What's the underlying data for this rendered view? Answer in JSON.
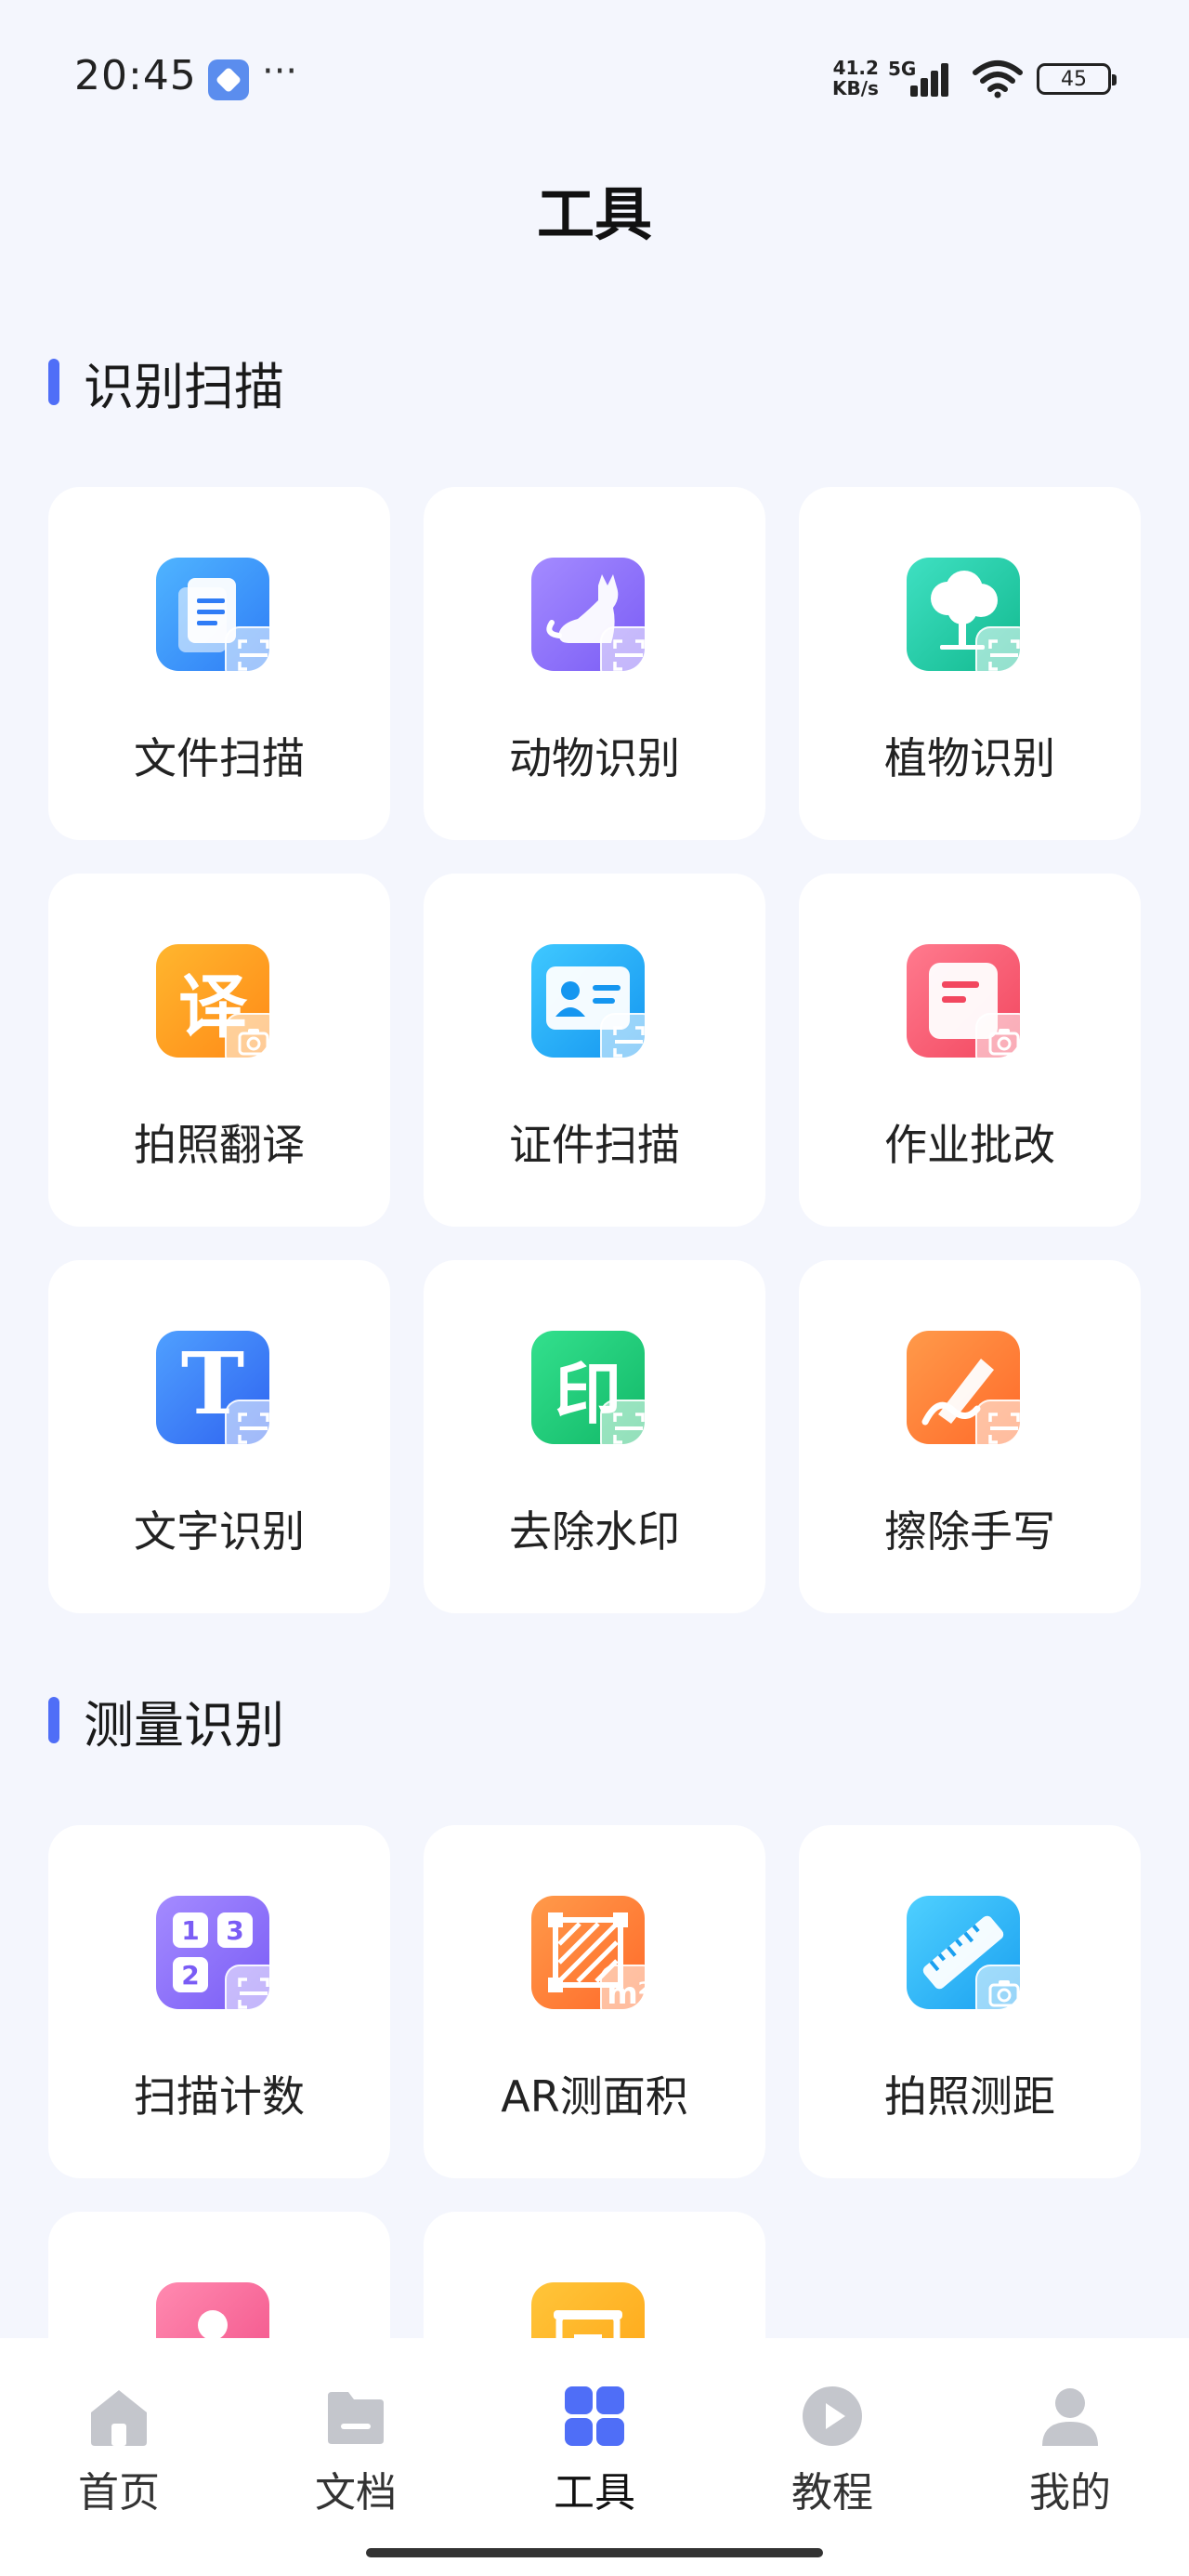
{
  "status_bar": {
    "time": "20:45",
    "more": "···",
    "net_speed_value": "41.2",
    "net_speed_unit": "KB/s",
    "net_type": "5G",
    "battery": "45"
  },
  "page": {
    "title": "工具"
  },
  "sections": [
    {
      "title": "识别扫描",
      "tools": [
        {
          "label": "文件扫描",
          "icon": "document-scan-icon"
        },
        {
          "label": "动物识别",
          "icon": "cat-scan-icon"
        },
        {
          "label": "植物识别",
          "icon": "tree-scan-icon"
        },
        {
          "label": "拍照翻译",
          "icon": "translate-camera-icon",
          "glyph": "译"
        },
        {
          "label": "证件扫描",
          "icon": "id-card-scan-icon"
        },
        {
          "label": "作业批改",
          "icon": "homework-camera-icon"
        },
        {
          "label": "文字识别",
          "icon": "text-scan-icon",
          "glyph": "T"
        },
        {
          "label": "去除水印",
          "icon": "watermark-scan-icon",
          "glyph": "印"
        },
        {
          "label": "擦除手写",
          "icon": "handwriting-erase-icon"
        }
      ]
    },
    {
      "title": "测量识别",
      "tools": [
        {
          "label": "扫描计数",
          "icon": "count-scan-icon",
          "glyphs": [
            "1",
            "3",
            "2"
          ]
        },
        {
          "label": "AR测面积",
          "icon": "ar-area-icon",
          "glyph": "m²"
        },
        {
          "label": "拍照测距",
          "icon": "ruler-camera-icon"
        },
        {
          "label": "",
          "icon": "person-scan-icon"
        },
        {
          "label": "",
          "icon": "yellow-tool-icon"
        }
      ]
    }
  ],
  "bottom_nav": {
    "items": [
      {
        "label": "首页",
        "icon": "home-icon"
      },
      {
        "label": "文档",
        "icon": "folder-icon"
      },
      {
        "label": "工具",
        "icon": "grid-icon",
        "active": true
      },
      {
        "label": "教程",
        "icon": "play-icon"
      },
      {
        "label": "我的",
        "icon": "user-icon"
      }
    ]
  },
  "colors": {
    "accent": "#4f6ef7",
    "background": "#f4f6fd",
    "card": "#ffffff",
    "nav_inactive": "#c4c6cc"
  }
}
